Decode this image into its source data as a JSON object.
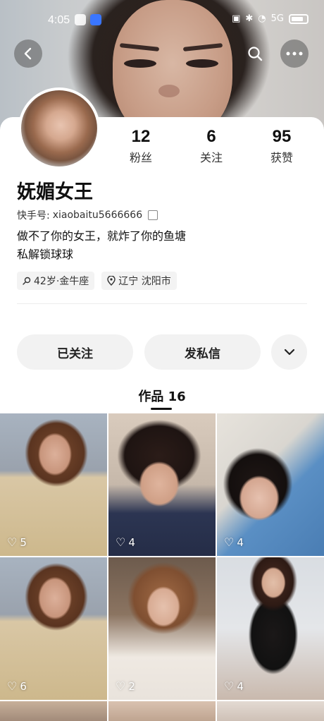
{
  "status_bar": {
    "time": "4:05",
    "network": "5G",
    "battery_level": 0.6
  },
  "header": {
    "back_icon": "chevron-left-icon",
    "search_icon": "search-icon",
    "more_icon": "more-dots-icon"
  },
  "profile": {
    "stats": [
      {
        "num": "12",
        "label": "粉丝"
      },
      {
        "num": "6",
        "label": "关注"
      },
      {
        "num": "95",
        "label": "获赞"
      }
    ],
    "name": "妩媚女王",
    "user_id_label": "快手号:",
    "user_id": "xiaobaitu5666666",
    "bio_line1": "做不了你的女王，就炸了你的鱼塘",
    "bio_line2": "私解锁球球",
    "tag_age": "42岁·金牛座",
    "tag_location": "辽宁 沈阳市"
  },
  "actions": {
    "follow_label": "已关注",
    "message_label": "发私信",
    "dropdown_icon": "chevron-down-icon"
  },
  "works": {
    "tab_label": "作品 16",
    "items": [
      {
        "likes": "5"
      },
      {
        "likes": "4"
      },
      {
        "likes": "4"
      },
      {
        "likes": "6"
      },
      {
        "likes": "2"
      },
      {
        "likes": "4"
      }
    ]
  },
  "colors": {
    "accent": "#111111",
    "button_bg": "#f2f2f2",
    "tag_bg": "#f3f3f3"
  }
}
